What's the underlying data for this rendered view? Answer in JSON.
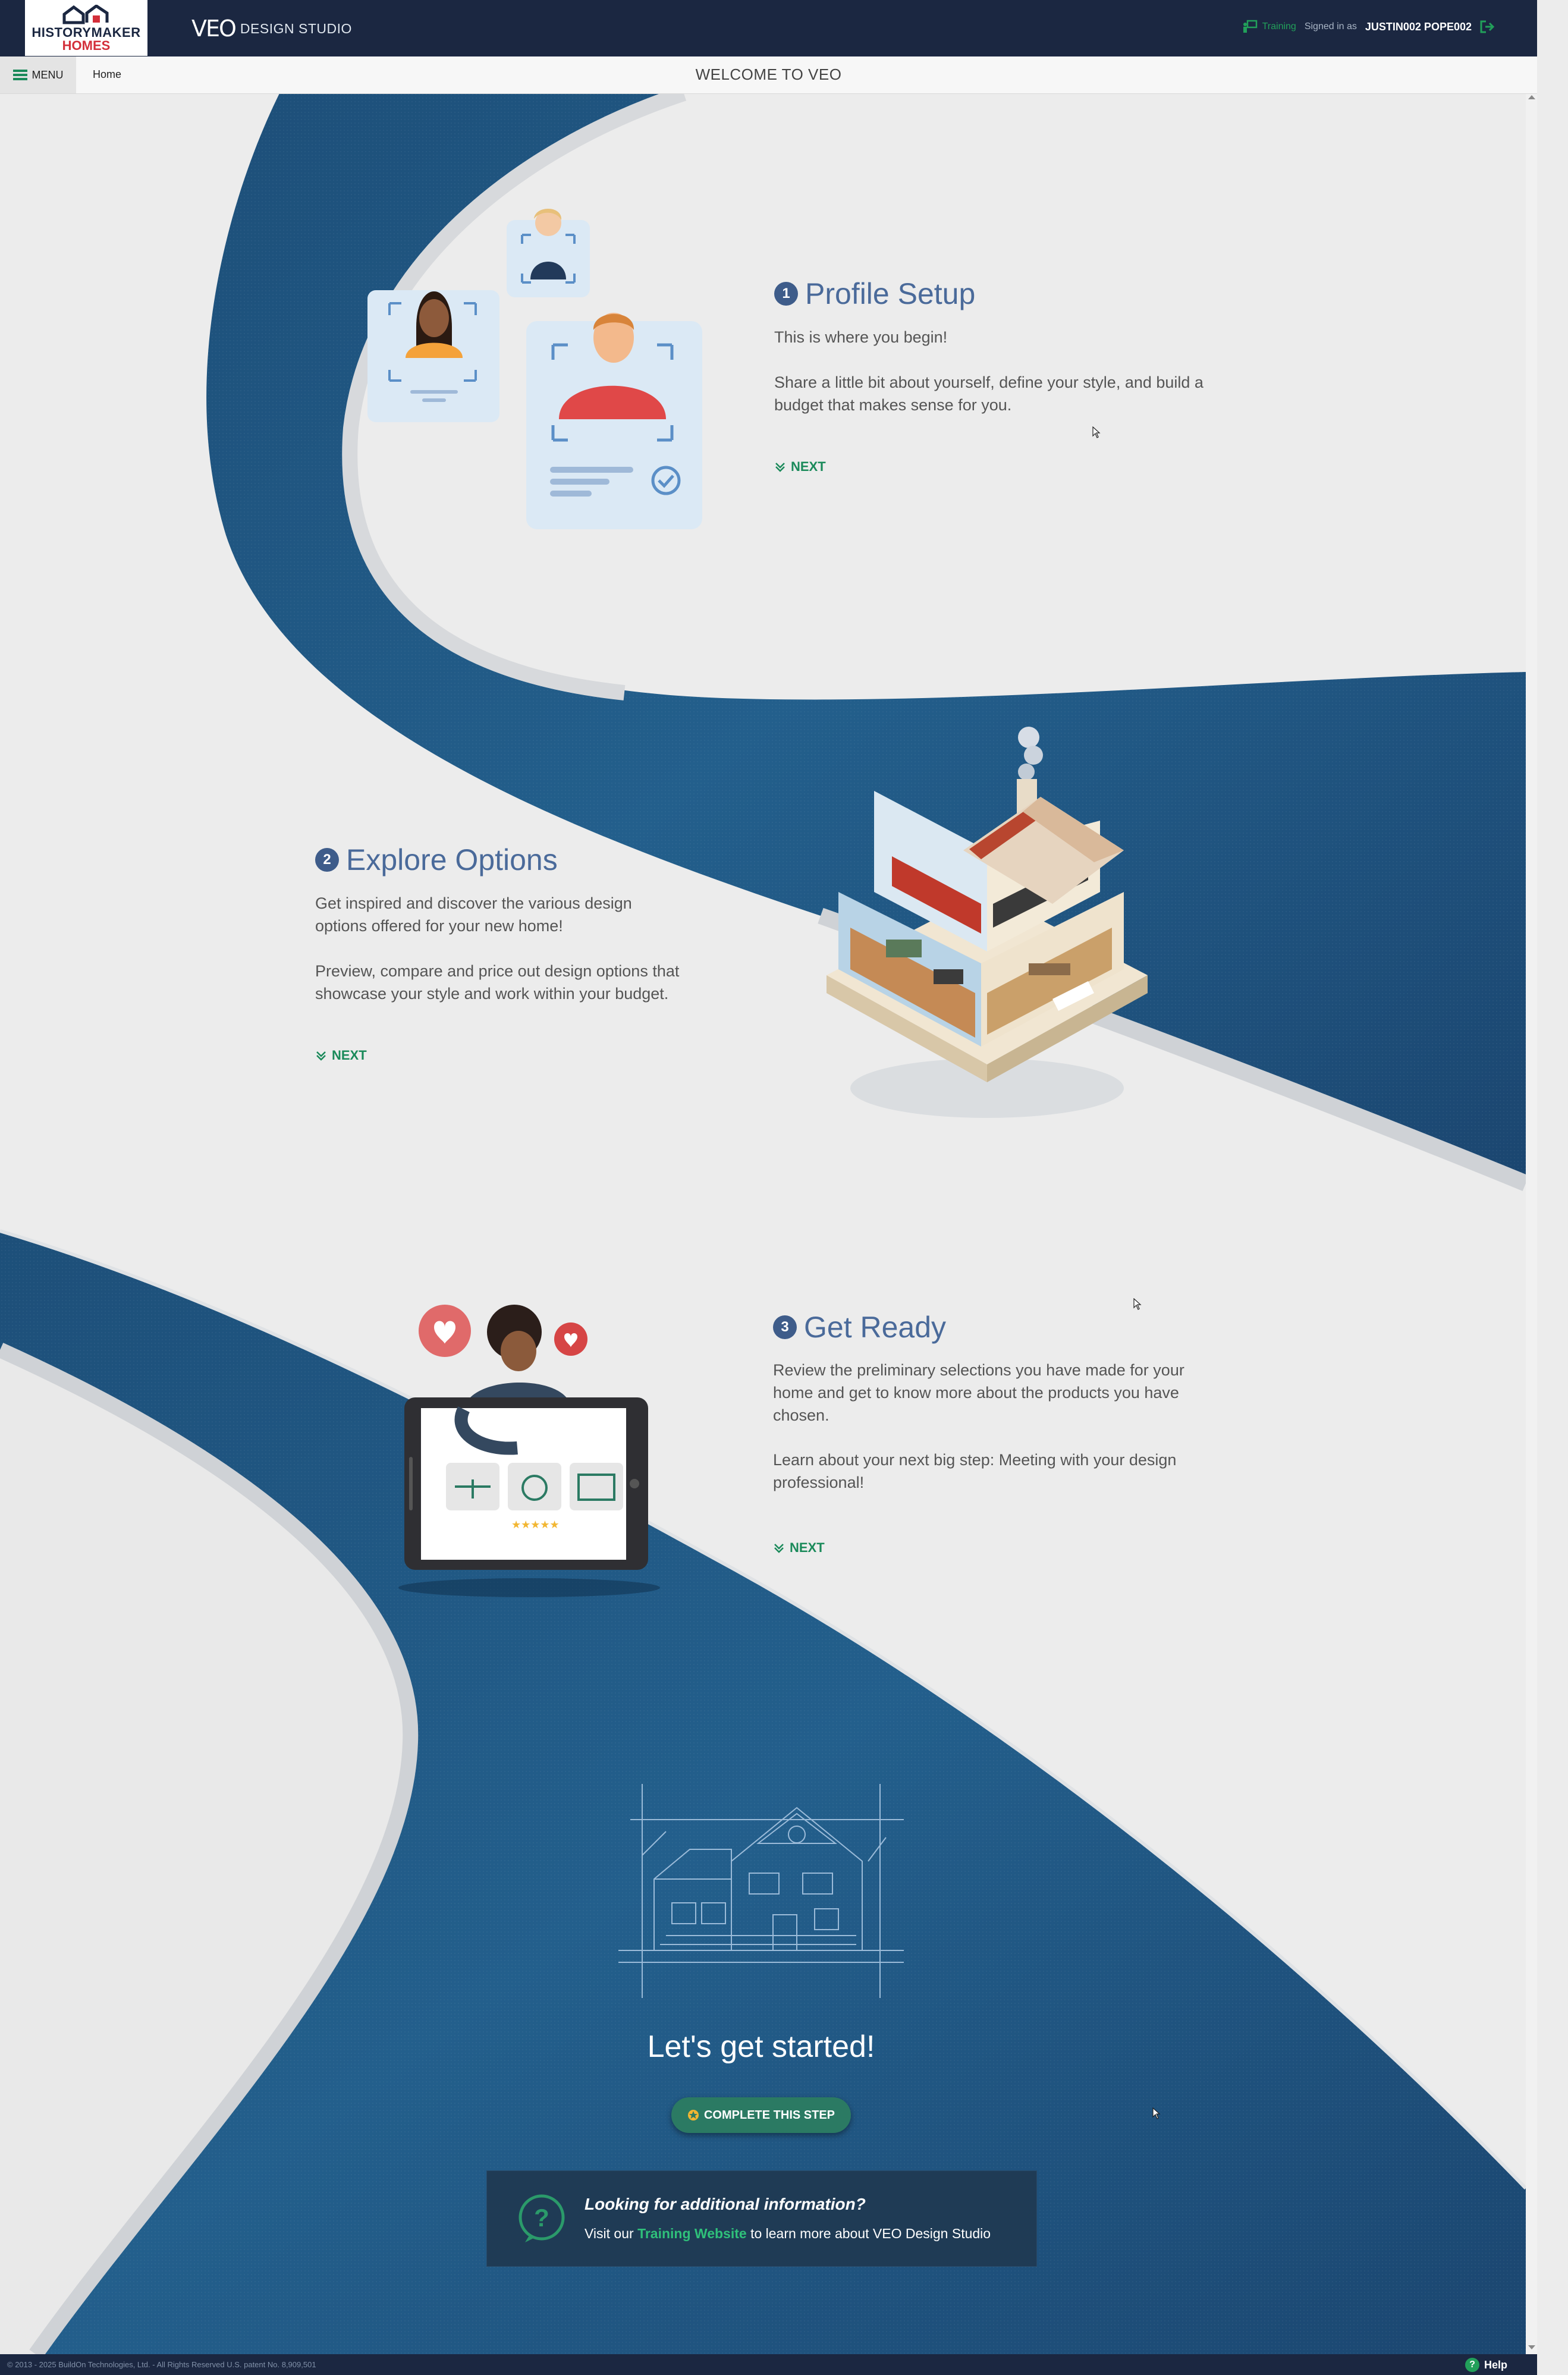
{
  "header": {
    "brand_line1": "HISTORYMAKER",
    "brand_line2": "HOMES",
    "app_mark": "VEO",
    "app_sub": "DESIGN STUDIO",
    "training_label": "Training",
    "signed_in_label": "Signed in as",
    "user_name": "JUSTIN002 POPE002"
  },
  "nav": {
    "menu_label": "MENU",
    "home_label": "Home",
    "page_title": "WELCOME TO VEO"
  },
  "steps": [
    {
      "number": "1",
      "title": "Profile Setup",
      "paragraphs": [
        "This is where you begin!",
        "Share a little bit about yourself, define your style, and build a budget that makes sense for you."
      ],
      "next_label": "NEXT"
    },
    {
      "number": "2",
      "title": "Explore Options",
      "paragraphs": [
        "Get inspired and discover the various design options offered for your new home!",
        "Preview, compare and price out design options that showcase your style and work within your budget."
      ],
      "next_label": "NEXT"
    },
    {
      "number": "3",
      "title": "Get Ready",
      "paragraphs": [
        "Review the preliminary selections you have made for your home and get to know more about the products you have chosen.",
        "Learn about your next big step: Meeting with your design professional!"
      ],
      "next_label": "NEXT"
    }
  ],
  "cta": {
    "title": "Let's get started!",
    "button_label": "COMPLETE THIS STEP"
  },
  "info": {
    "heading": "Looking for additional information?",
    "prefix": "Visit our",
    "link_text": "Training Website",
    "suffix": "to learn more about VEO Design Studio"
  },
  "footer": {
    "copyright": "© 2013 - 2025 BuildOn Technologies, Ltd. - All Rights Reserved U.S. patent No. 8,909,501",
    "help_label": "Help"
  },
  "colors": {
    "header_bg": "#1b2741",
    "accent_green": "#22a05a",
    "brand_red": "#d32f3a",
    "wave_blue": "#1e5a86",
    "step_title": "#4a6a9a"
  },
  "icons": [
    "menu-icon",
    "logout-icon",
    "training-icon",
    "chevron-down-icon",
    "star-icon",
    "question-icon",
    "help-icon"
  ]
}
